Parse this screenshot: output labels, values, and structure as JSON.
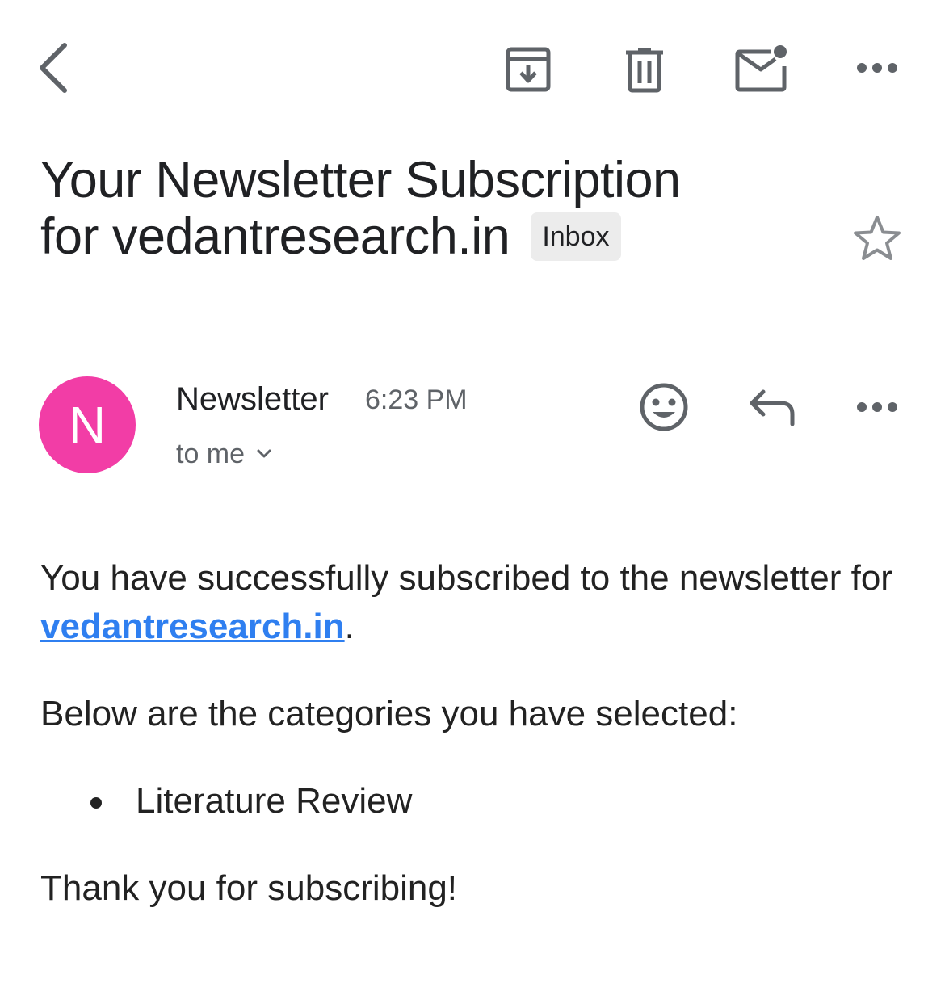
{
  "toolbar": {
    "back_icon": "chevron-left-icon",
    "archive_icon": "archive-icon",
    "delete_icon": "trash-icon",
    "mark_unread_icon": "mail-unread-icon",
    "more_icon": "more-horizontal-icon"
  },
  "email": {
    "subject_line1": "Your Newsletter Subscription",
    "subject_line2": "for vedantresearch.in",
    "label": "Inbox",
    "starred": false
  },
  "sender": {
    "avatar_initial": "N",
    "avatar_color": "#f23da6",
    "name": "Newsletter",
    "time": "6:23 PM",
    "recipient": "to me"
  },
  "body": {
    "para1_text": "You have successfully subscribed to the newsletter for ",
    "link_text": "vedantresearch.in",
    "para1_end": ".",
    "para2": "Below are the categories you have selected:",
    "categories": [
      "Literature Review"
    ],
    "para3": "Thank you for subscribing!"
  },
  "colors": {
    "link": "#2f7ff0",
    "icon": "#5f6368",
    "label_bg": "#ececec"
  }
}
